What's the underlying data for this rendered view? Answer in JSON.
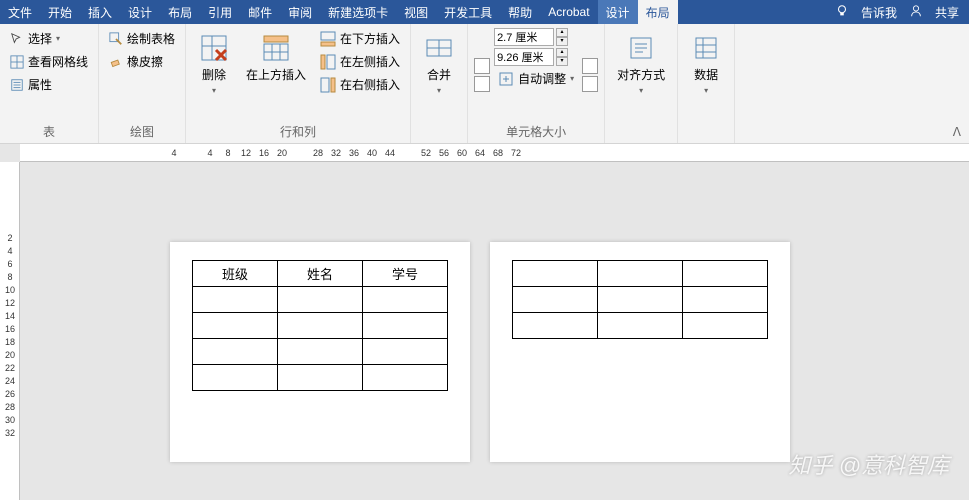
{
  "tabs": {
    "file": "文件",
    "home": "开始",
    "insert": "插入",
    "design": "设计",
    "layout": "布局",
    "references": "引用",
    "mailings": "邮件",
    "review": "审阅",
    "newtab": "新建选项卡",
    "view": "视图",
    "devtools": "开发工具",
    "help": "帮助",
    "acrobat": "Acrobat",
    "tbl_design": "设计",
    "tbl_layout": "布局"
  },
  "title_right": {
    "tellme": "告诉我",
    "share": "共享"
  },
  "ribbon": {
    "table_group": {
      "select": "选择",
      "gridlines": "查看网格线",
      "properties": "属性",
      "label": "表"
    },
    "draw_group": {
      "draw": "绘制表格",
      "eraser": "橡皮擦",
      "label": "绘图"
    },
    "delete": "删除",
    "insert_above": "在上方插入",
    "insert_below": "在下方插入",
    "insert_left": "在左侧插入",
    "insert_right": "在右侧插入",
    "rows_cols_label": "行和列",
    "merge": "合并",
    "height_value": "2.7 厘米",
    "width_value": "9.26 厘米",
    "autofit": "自动调整",
    "cellsize_label": "单元格大小",
    "alignment": "对齐方式",
    "data": "数据"
  },
  "ruler_h": [
    "4",
    "",
    "4",
    "8",
    "12",
    "16",
    "20",
    "",
    "28",
    "32",
    "36",
    "40",
    "44",
    "",
    "52",
    "56",
    "60",
    "64",
    "68",
    "72",
    ""
  ],
  "ruler_v": [
    "2",
    "",
    "2",
    "4",
    "",
    "6",
    "8",
    "",
    "",
    "",
    "",
    "",
    "",
    "",
    "",
    "",
    "",
    "",
    "",
    "",
    ""
  ],
  "ruler_v2": [
    "2",
    "4",
    "6",
    "8",
    "10",
    "12",
    "14",
    "16",
    "18",
    "20",
    "22",
    "24",
    "26",
    "28",
    "30",
    "32"
  ],
  "doc": {
    "headers": [
      "班级",
      "姓名",
      "学号"
    ]
  },
  "watermark": "知乎 @意科智库"
}
